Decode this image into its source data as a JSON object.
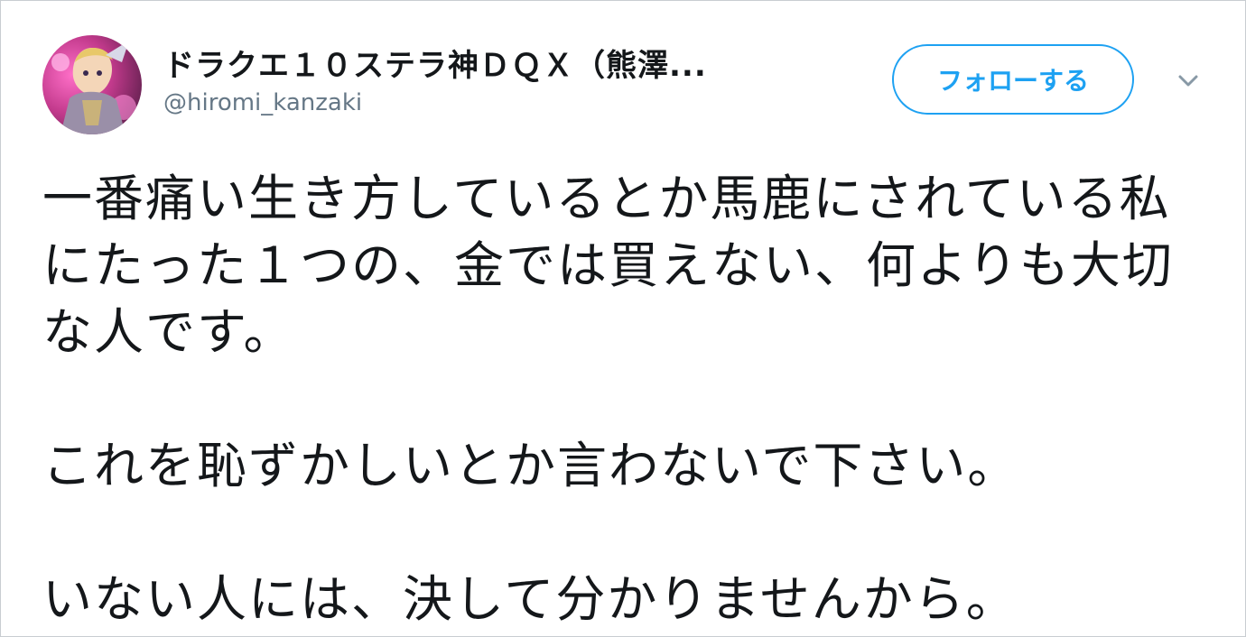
{
  "user": {
    "display_name": "ドラクエ１０ステラ神ＤＱＸ（熊澤...",
    "handle": "@hiromi_kanzaki"
  },
  "follow_button": {
    "label": "フォローする"
  },
  "colors": {
    "accent": "#1da1f2",
    "text": "#14171a",
    "secondary": "#657786"
  },
  "icons": {
    "menu": "chevron-down-icon",
    "avatar": "avatar-image"
  },
  "tweet": {
    "paragraphs": [
      "一番痛い生き方しているとか馬鹿にされている私にたった１つの、金では買えない、何よりも大切な人です。",
      "これを恥ずかしいとか言わないで下さい。",
      "いない人には、決して分かりませんから。"
    ]
  }
}
